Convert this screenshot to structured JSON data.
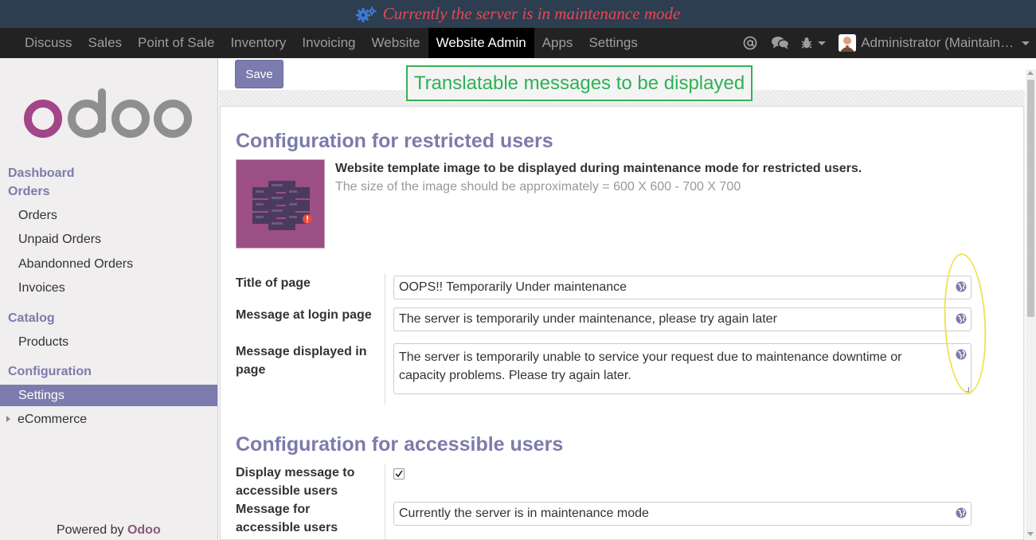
{
  "banner": {
    "text": "Currently the server is in maintenance mode"
  },
  "topnav": {
    "items": [
      "Discuss",
      "Sales",
      "Point of Sale",
      "Inventory",
      "Invoicing",
      "Website",
      "Website Admin",
      "Apps",
      "Settings"
    ],
    "active": "Website Admin",
    "user": "Administrator (Maintain…"
  },
  "sidebar": {
    "logo": "odoo",
    "sections": [
      "Dashboard",
      "Orders",
      "Catalog",
      "Configuration"
    ],
    "items": [
      "Orders",
      "Unpaid Orders",
      "Abandonned Orders",
      "Invoices",
      "Products",
      "Settings",
      "eCommerce"
    ],
    "active": "Settings",
    "powered_prefix": "Powered by",
    "powered_brand": "Odoo"
  },
  "toolbar": {
    "save_label": "Save"
  },
  "annotation": "Translatable messages to be displayed",
  "restricted": {
    "title": "Configuration for restricted users",
    "image_desc": "Website template image to be displayed during maintenance mode for restricted users.",
    "image_hint": "The size of the image should be approximately = 600 X 600 - 700 X 700",
    "fields": [
      {
        "label": "Title of page",
        "value": "OOPS!! Temporarily Under maintenance"
      },
      {
        "label": "Message at login page",
        "value": "The server is temporarily under maintenance, please try again later"
      },
      {
        "label": "Message displayed in page",
        "value": "The server is temporarily unable to service your request due to maintenance downtime or capacity problems. Please try again later."
      }
    ]
  },
  "accessible": {
    "title": "Configuration for accessible users",
    "display_label": "Display message to accessible users",
    "display_checked": true,
    "message_label": "Message for accessible users",
    "message_value": "Currently the server is in maintenance mode"
  },
  "colors": {
    "accent": "#7c7bad",
    "banner_bg": "#2d3e50",
    "banner_text": "#e64855",
    "annotation": "#2eb155",
    "highlight": "#f0e25a"
  }
}
